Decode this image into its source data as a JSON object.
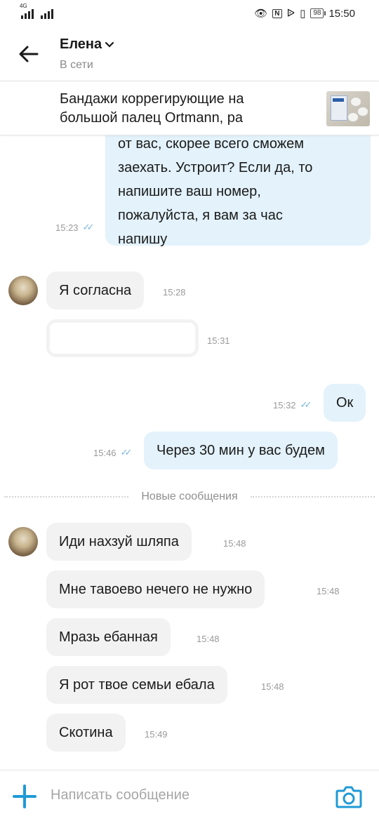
{
  "statusbar": {
    "net_tag": "4G",
    "battery": "98",
    "time": "15:50"
  },
  "header": {
    "name": "Елена",
    "status": "В сети"
  },
  "product": {
    "title": "Бандажи коррегирующие на большой палец Ortmann, ра"
  },
  "messages": {
    "m1": {
      "lines": [
        "от вас, скорее всего сможем",
        "заехать. Устроит? Если да, то",
        "напишите ваш номер,",
        "пожалуйста, я вам за час",
        "напишу"
      ],
      "time": "15:23"
    },
    "m2": {
      "text": "Я согласна",
      "time": "15:28"
    },
    "m3": {
      "text": "",
      "time": "15:31"
    },
    "m4": {
      "text": "Ок",
      "time": "15:32"
    },
    "m5": {
      "text": "Через 30 мин у вас будем",
      "time": "15:46"
    },
    "m6": {
      "text": "Иди нахзуй шляпа",
      "time": "15:48"
    },
    "m7": {
      "text": "Мне тавоево  нечего не нужно",
      "time": "15:48"
    },
    "m8": {
      "text": "Мразь ебанная",
      "time": "15:48"
    },
    "m9": {
      "text": "Я рот твое семьи ебала",
      "time": "15:48"
    },
    "m10": {
      "text": "Скотина",
      "time": "15:49"
    }
  },
  "separator": {
    "label": "Новые сообщения"
  },
  "composer": {
    "placeholder": "Написать сообщение"
  },
  "colors": {
    "accent": "#1f9ad6",
    "out_bubble": "#e3f2fb",
    "in_bubble": "#f2f2f2",
    "read_ticks": "#7ab8dd"
  }
}
